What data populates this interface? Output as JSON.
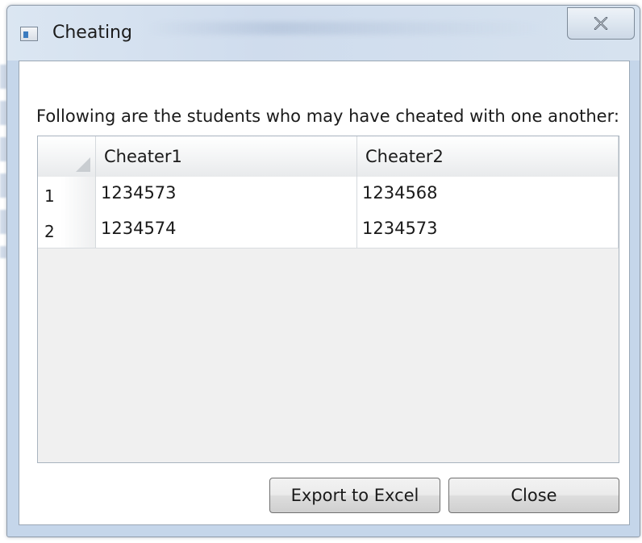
{
  "window": {
    "title": "Cheating",
    "close_glyph": "✕"
  },
  "prompt": "Following are the students who may have cheated with one another:",
  "grid": {
    "columns": [
      "Cheater1",
      "Cheater2"
    ],
    "rows": [
      {
        "num": "1",
        "cells": [
          "1234573",
          "1234568"
        ]
      },
      {
        "num": "2",
        "cells": [
          "1234574",
          "1234573"
        ]
      }
    ]
  },
  "buttons": {
    "export": "Export to Excel",
    "close": "Close"
  }
}
